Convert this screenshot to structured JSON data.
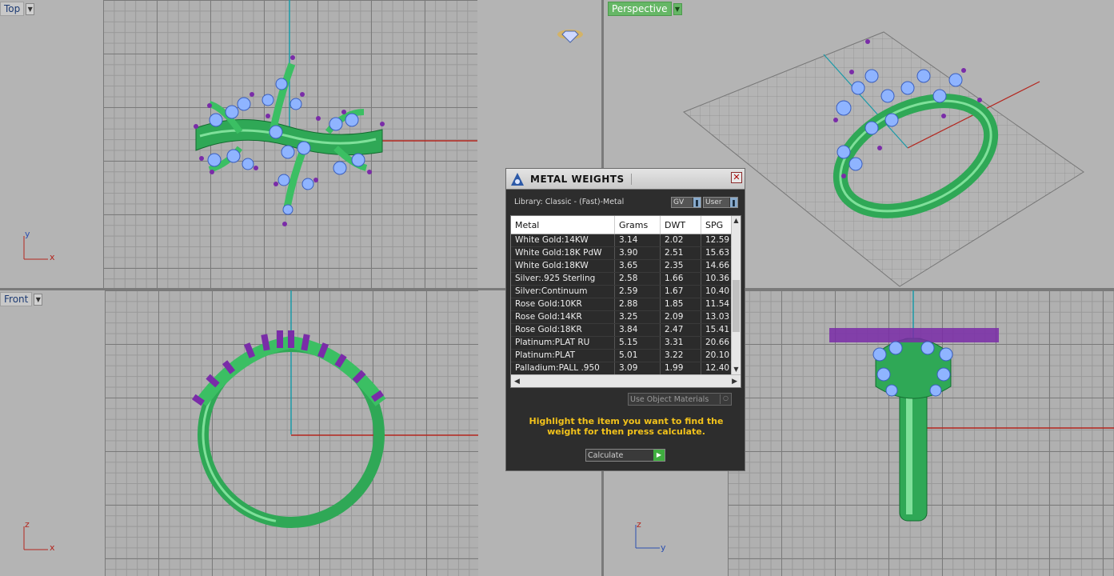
{
  "viewports": {
    "top": {
      "label": "Top",
      "axis_v": "y",
      "axis_h": "x"
    },
    "perspective": {
      "label": "Perspective"
    },
    "front": {
      "label": "Front",
      "axis_v": "z",
      "axis_h": "x"
    },
    "right": {
      "axis_v": "z",
      "axis_h": "y"
    }
  },
  "dialog": {
    "title": "METAL WEIGHTS",
    "close": "✕",
    "library": "Library: Classic - (Fast)-Metal",
    "gv_label": "GV",
    "user_label": "User",
    "columns": [
      "Metal",
      "Grams",
      "DWT",
      "SPG"
    ],
    "rows": [
      [
        "White Gold:14KW",
        "3.14",
        "2.02",
        "12.59"
      ],
      [
        "White Gold:18K PdW",
        "3.90",
        "2.51",
        "15.63"
      ],
      [
        "White Gold:18KW",
        "3.65",
        "2.35",
        "14.66"
      ],
      [
        "Silver:.925 Sterling",
        "2.58",
        "1.66",
        "10.36"
      ],
      [
        "Silver:Continuum",
        "2.59",
        "1.67",
        "10.40"
      ],
      [
        "Rose Gold:10KR",
        "2.88",
        "1.85",
        "11.54"
      ],
      [
        "Rose Gold:14KR",
        "3.25",
        "2.09",
        "13.03"
      ],
      [
        "Rose Gold:18KR",
        "3.84",
        "2.47",
        "15.41"
      ],
      [
        "Platinum:PLAT RU",
        "5.15",
        "3.31",
        "20.66"
      ],
      [
        "Platinum:PLAT",
        "5.01",
        "3.22",
        "20.10"
      ],
      [
        "Palladium:PALL .950",
        "3.09",
        "1.99",
        "12.40"
      ]
    ],
    "use_object_materials": "Use Object Materials",
    "hint": "Highlight the item you want to find the weight for then press calculate.",
    "calculate": "Calculate"
  },
  "colors": {
    "ring": "#3bbf63",
    "stone": "#8fb4ff",
    "prong": "#7a2ca8",
    "active_viewport": "#66b766",
    "hint_text": "#f2c21b"
  }
}
